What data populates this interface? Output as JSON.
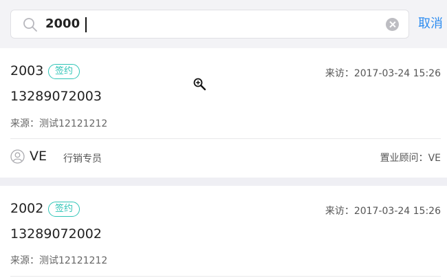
{
  "search": {
    "query": "2000",
    "cancel_label": "取消"
  },
  "results": [
    {
      "name": "2003",
      "status": "签约",
      "visit_label": "来访：",
      "visit_time": "2017-03-24 15:26",
      "phone": "13289072003",
      "source_label": "来源：",
      "source": "测试12121212",
      "agent_name": "VE",
      "agent_role": "行销专员",
      "advisor_label": "置业顾问：",
      "advisor": "VE"
    },
    {
      "name": "2002",
      "status": "签约",
      "visit_label": "来访：",
      "visit_time": "2017-03-24 15:26",
      "phone": "13289072002",
      "source_label": "来源：",
      "source": "测试12121212"
    }
  ],
  "colors": {
    "accent": "#2d8cf0",
    "badge": "#2ec4b6",
    "background": "#efeff4"
  },
  "icons": [
    "search-icon",
    "clear-icon",
    "user-icon",
    "zoom-cursor-icon"
  ]
}
